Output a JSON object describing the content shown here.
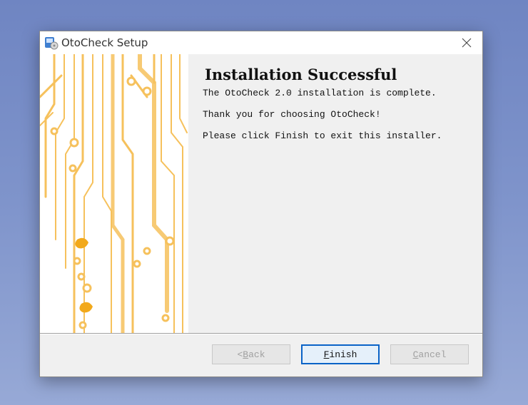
{
  "window": {
    "title": "OtoCheck Setup",
    "icon": "installer-icon",
    "close_icon": "close-icon"
  },
  "content": {
    "heading": "Installation Successful",
    "lines": [
      "The OtoCheck 2.0 installation is complete.",
      "Thank you for choosing OtoCheck!",
      "Please click Finish to exit this installer."
    ]
  },
  "buttons": {
    "back": {
      "prefix": "< ",
      "mnemonic": "B",
      "rest": "ack",
      "enabled": false
    },
    "finish": {
      "mnemonic": "F",
      "rest": "inish",
      "enabled": true
    },
    "cancel": {
      "mnemonic": "C",
      "rest": "ancel",
      "enabled": false
    }
  },
  "colors": {
    "desktop": "#7a8fc8",
    "banner_trace": "#f6c15c",
    "focus_border": "#0a63c7"
  }
}
